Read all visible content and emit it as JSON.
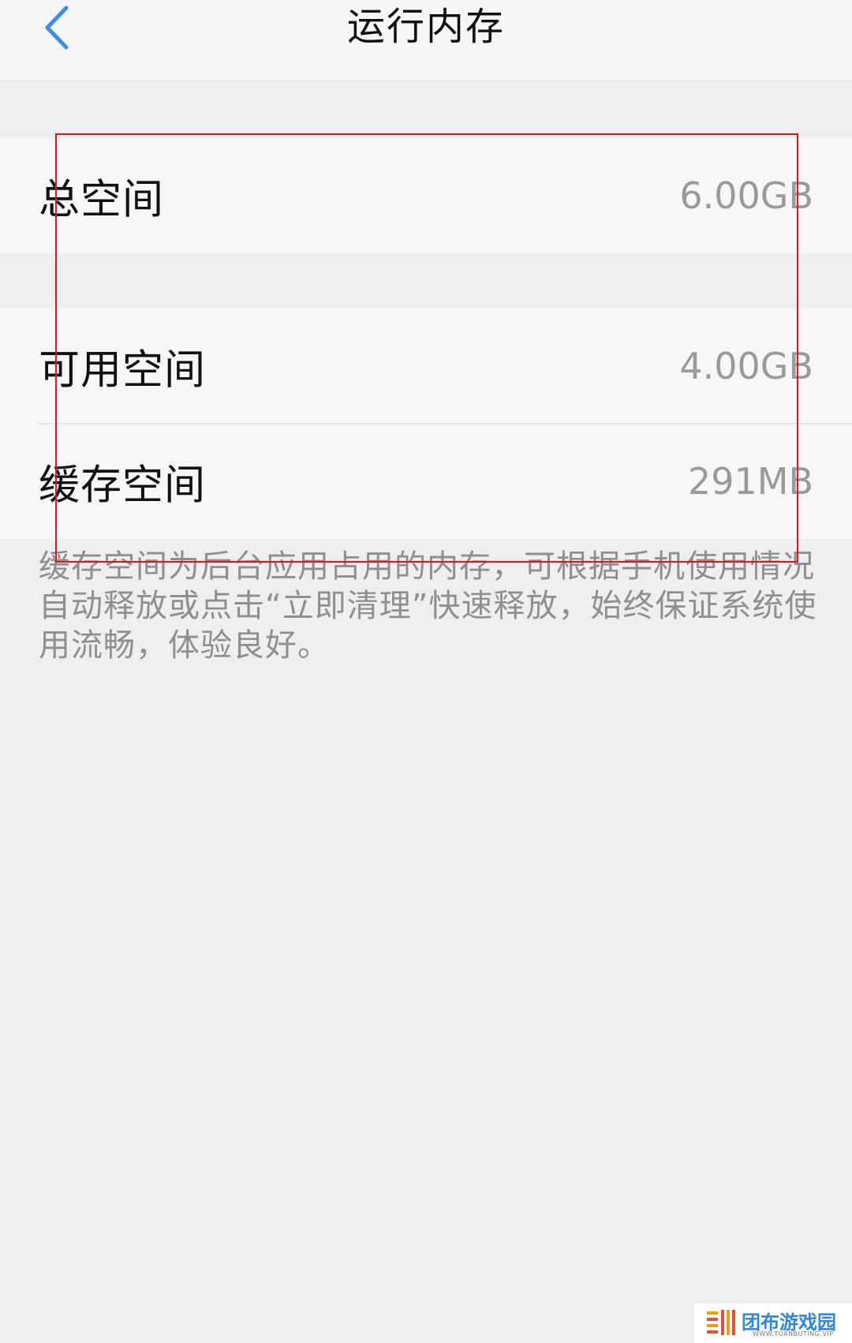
{
  "header": {
    "title": "运行内存",
    "back_icon": "chevron-left-icon",
    "back_color": "#3a8ee6"
  },
  "total": {
    "label": "总空间",
    "value": "6.00GB"
  },
  "memory": {
    "available_label": "可用空间",
    "available_value": "4.00GB",
    "cache_label": "缓存空间",
    "cache_value": "291MB"
  },
  "description": "缓存空间为后台应用占用的内存，可根据手机使用情况自动释放或点击“立即清理”快速释放，始终保证系统使用流畅，体验良好。",
  "watermark": {
    "name": "团布游戏园",
    "url": "WWW.TUANBUTING.VIP"
  },
  "colors": {
    "highlight": "#e01515",
    "background": "#efefef",
    "card": "#f7f7f7"
  }
}
